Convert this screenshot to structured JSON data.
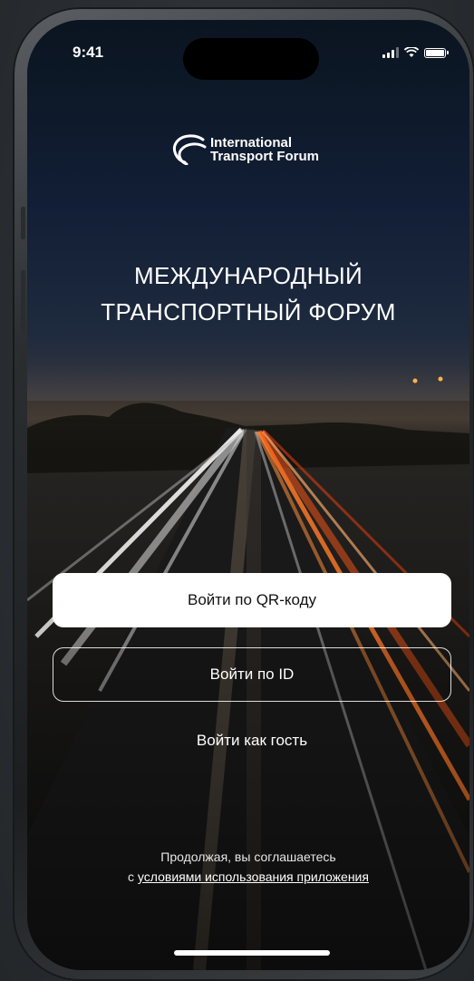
{
  "status_bar": {
    "time": "9:41"
  },
  "logo": {
    "line1": "International",
    "line2": "Transport Forum"
  },
  "hero": {
    "title_line1": "МЕЖДУНАРОДНЫЙ",
    "title_line2": "ТРАНСПОРТНЫЙ ФОРУМ"
  },
  "actions": {
    "qr_label": "Войти по QR-коду",
    "id_label": "Войти по ID",
    "guest_label": "Войти как гость"
  },
  "consent": {
    "line1": "Продолжая, вы соглашаетесь",
    "prefix": "с",
    "link_text": "условиями использования приложения"
  },
  "colors": {
    "primary_button": "#ffffff",
    "text": "#ffffff",
    "background_sky": "#0d1826"
  }
}
